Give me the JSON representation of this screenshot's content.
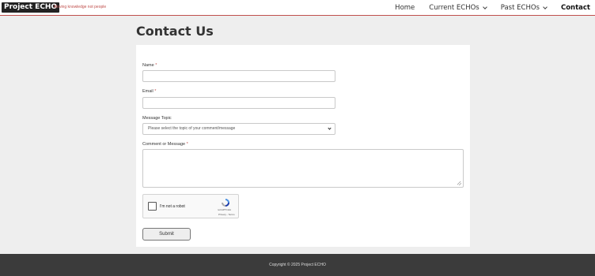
{
  "header": {
    "logo": "Project ECHO",
    "tagline": "Moving knowledge not people",
    "nav": [
      {
        "label": "Home"
      },
      {
        "label": "Current ECHOs"
      },
      {
        "label": "Past ECHOs"
      },
      {
        "label": "Contact"
      }
    ],
    "accent_color": "#c0504d"
  },
  "main": {
    "title": "Contact Us",
    "form": {
      "name_label": "Name",
      "email_label": "Email",
      "topic_label": "Message Topic",
      "topic_selected": "Please select the topic of your comment/message",
      "comment_label": "Comment or Message",
      "required_marker": "*",
      "captcha_text": "I'm not a robot",
      "captcha_brand": "reCAPTCHA",
      "captcha_links": "Privacy - Terms",
      "submit_label": "Submit"
    }
  },
  "footer": {
    "copyright": "Copyright © 2025 Project ECHO"
  }
}
